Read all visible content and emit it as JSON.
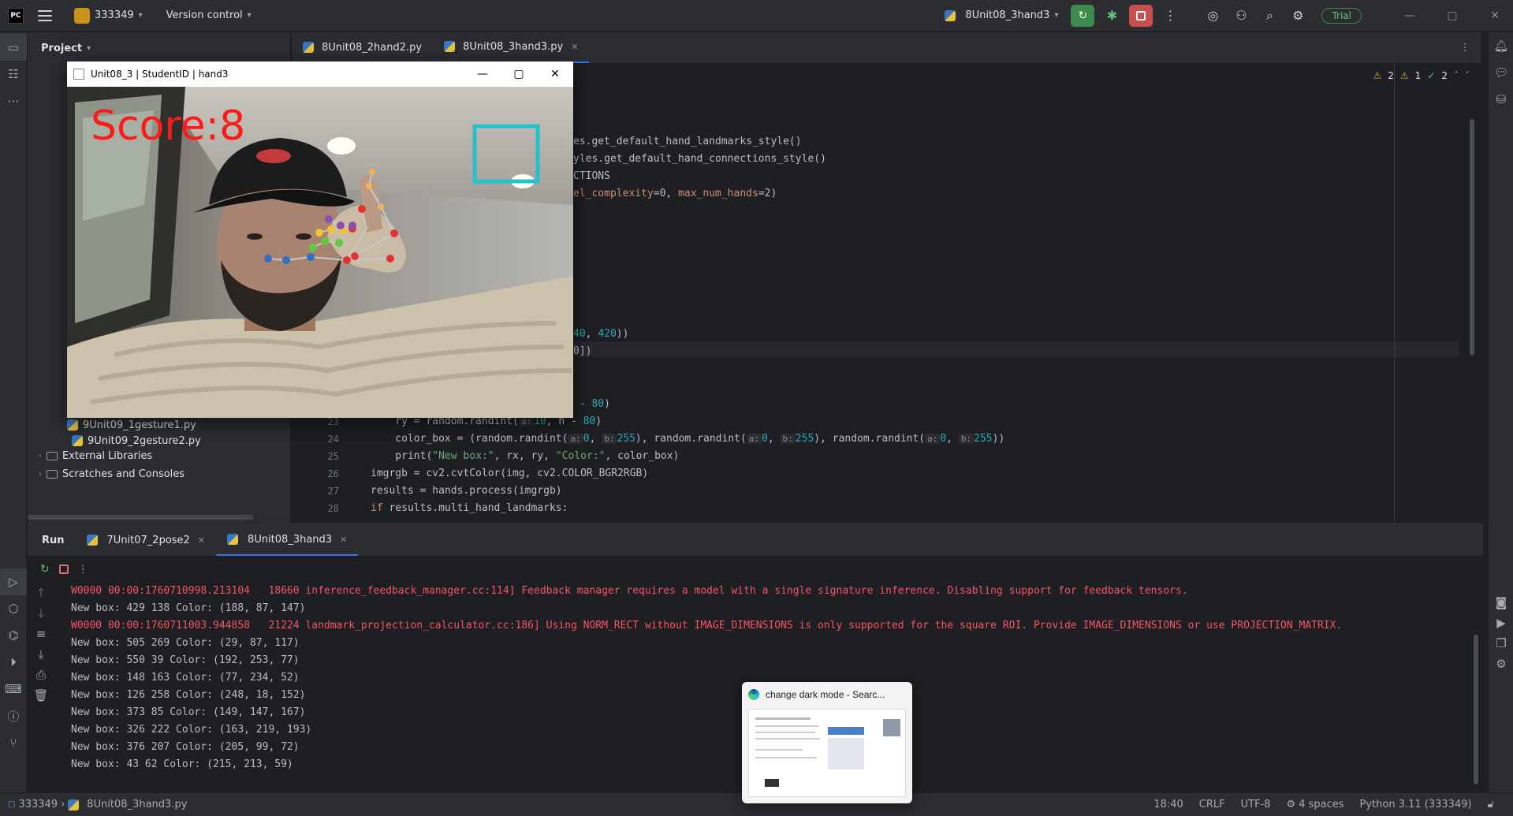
{
  "titlebar": {
    "logo": "PC",
    "project_name": "333349",
    "vcs": "Version control",
    "run_config": "8Unit08_3hand3",
    "trial": "Trial"
  },
  "project_pane": {
    "title": "Project",
    "files": [
      "9Unit09_1gesture1.py",
      "9Unit09_2gesture2.py"
    ],
    "external": "External Libraries",
    "scratches": "Scratches and Consoles"
  },
  "editor": {
    "tabs": [
      {
        "label": "8Unit08_2hand2.py"
      },
      {
        "label": "8Unit08_3hand3.py"
      }
    ],
    "inspections": {
      "warn": "2",
      "weak": "1",
      "ok": "2"
    },
    "fragments": {
      "l1": "es.get_default_hand_landmarks_style()",
      "l2": "yles.get_default_hand_connections_style()",
      "l3": "CTIONS",
      "l4a": "el_complexity",
      "l4b": "=0, ",
      "l4c": "max_num_hands",
      "l4d": "=2)",
      "l5a": "40",
      "l5b": ", ",
      "l5c": "420",
      "l5d": "))",
      "l6": "0])",
      "l7a": " - ",
      "l7b": "80",
      "l7c": ")"
    },
    "lines": [
      {
        "n": "23",
        "text_a": "    ry = random.randint(",
        "h1": "a:",
        "n1": "10",
        "text_b": ", h - ",
        "n2": "80",
        "text_c": ")"
      },
      {
        "n": "24",
        "text": "    color_box = (random.randint(",
        "h1": "a:",
        "n1": "0",
        "c1": ", ",
        "h2": "b:",
        "n2": "255",
        "c2": "), random.randint(",
        "h3": "a:",
        "n3": "0",
        "c3": ", ",
        "h4": "b:",
        "n4": "255",
        "c4": "), random.randint(",
        "h5": "a:",
        "n5": "0",
        "c5": ", ",
        "h6": "b:",
        "n6": "255",
        "c6": "))"
      },
      {
        "n": "25",
        "text_a": "    print(",
        "s1": "\"New box:\"",
        "text_b": ", rx, ry, ",
        "s2": "\"Color:\"",
        "text_c": ", color_box)"
      },
      {
        "n": "26",
        "text": "imgrgb = cv2.cvtColor(img, cv2.COLOR_BGR2RGB)"
      },
      {
        "n": "27",
        "text": "results = hands.process(imgrgb)"
      },
      {
        "n": "28",
        "kw": "if",
        "text": " results.multi_hand_landmarks:"
      }
    ]
  },
  "cv_window": {
    "title": "Unit08_3 | StudentID | hand3",
    "score": "Score:8"
  },
  "run": {
    "label": "Run",
    "tabs": [
      {
        "label": "7Unit07_2pose2"
      },
      {
        "label": "8Unit08_3hand3"
      }
    ],
    "console": [
      {
        "type": "error",
        "text": "W0000 00:00:1760710998.213104   18660 inference_feedback_manager.cc:114] Feedback manager requires a model with a single signature inference. Disabling support for feedback tensors."
      },
      {
        "type": "out",
        "text": "New box: 429 138 Color: (188, 87, 147)"
      },
      {
        "type": "error",
        "text": "W0000 00:00:1760711003.944858   21224 landmark_projection_calculator.cc:186] Using NORM_RECT without IMAGE_DIMENSIONS is only supported for the square ROI. Provide IMAGE_DIMENSIONS or use PROJECTION_MATRIX."
      },
      {
        "type": "out",
        "text": "New box: 505 269 Color: (29, 87, 117)"
      },
      {
        "type": "out",
        "text": "New box: 550 39 Color: (192, 253, 77)"
      },
      {
        "type": "out",
        "text": "New box: 148 163 Color: (77, 234, 52)"
      },
      {
        "type": "out",
        "text": "New box: 126 258 Color: (248, 18, 152)"
      },
      {
        "type": "out",
        "text": "New box: 373 85 Color: (149, 147, 167)"
      },
      {
        "type": "out",
        "text": "New box: 326 222 Color: (163, 219, 193)"
      },
      {
        "type": "out",
        "text": "New box: 376 207 Color: (205, 99, 72)"
      },
      {
        "type": "out",
        "text": "New box: 43 62 Color: (215, 213, 59)"
      }
    ]
  },
  "thumbnail": {
    "title": "change dark mode - Searc..."
  },
  "status": {
    "project": "333349",
    "file": "8Unit08_3hand3.py",
    "position": "18:40",
    "line_sep": "CRLF",
    "encoding": "UTF-8",
    "indent": "4 spaces",
    "interpreter": "Python 3.11 (333349)"
  }
}
